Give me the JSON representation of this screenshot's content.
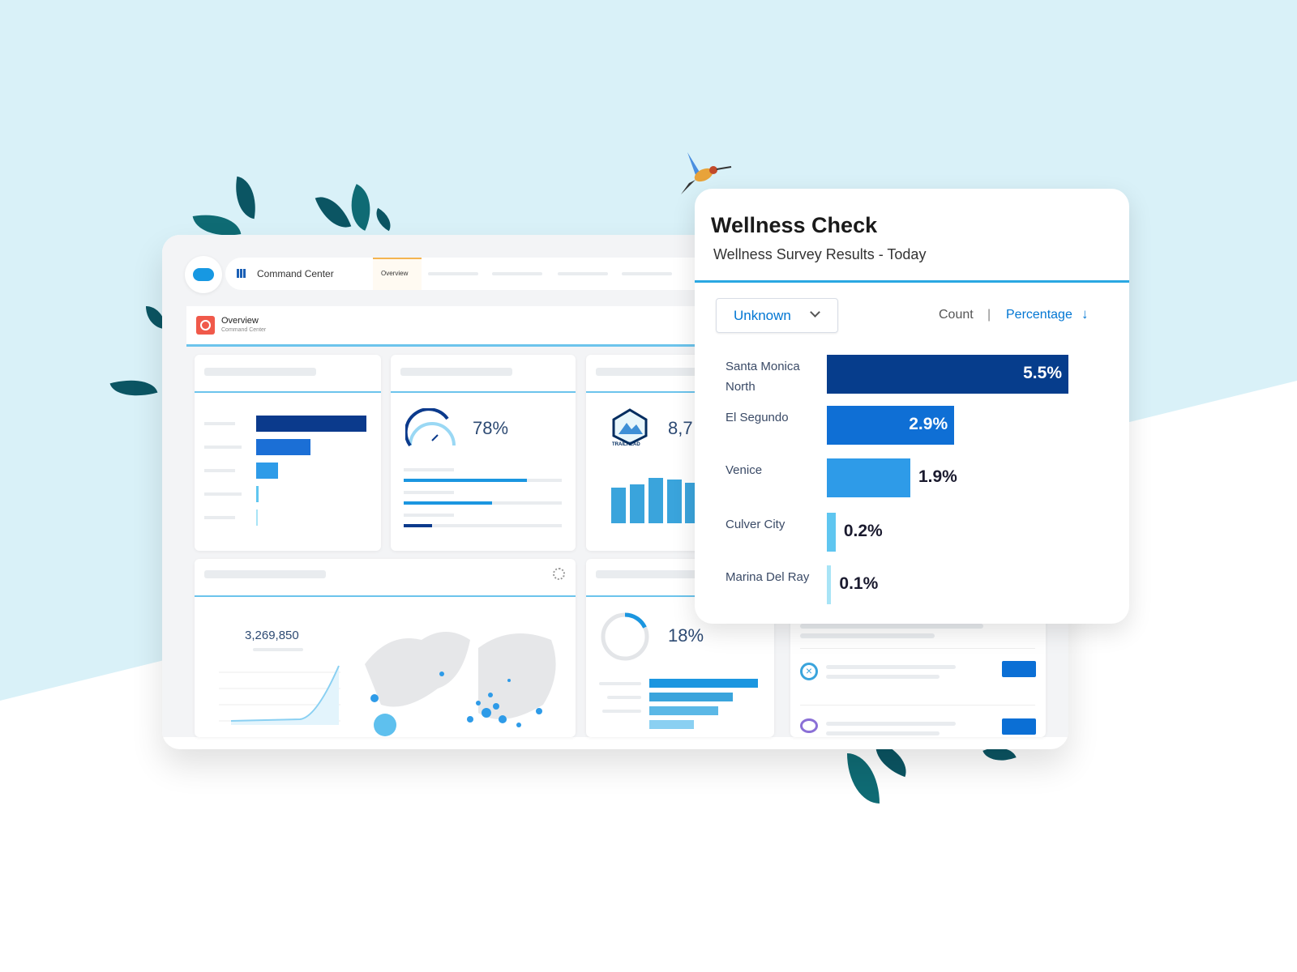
{
  "colors": {
    "background": "#d9f1f8",
    "accent": "#0176d3",
    "dark_bar": "#063d8c",
    "mid_bar": "#0f6fd5",
    "light_bar": "#2e9be8",
    "leaf": "#0b5563"
  },
  "dashboard": {
    "app_name": "Command Center",
    "active_tab": "Overview",
    "header": {
      "title": "Overview",
      "subtitle": "Command Center",
      "icon": "gauge-icon"
    },
    "gauge_value": "78%",
    "gauge_fraction": 0.78,
    "trailhead_logo": "TRAILHEAD",
    "trailhead_value": "8,7",
    "total_value": "3,269,850",
    "donut_value": "18%",
    "donut_fraction": 0.18,
    "progress_bars": [
      0.78,
      0.56,
      0.18
    ]
  },
  "wellness": {
    "title": "Wellness Check",
    "subtitle": "Wellness Survey Results - Today",
    "filter_value": "Unknown",
    "toggle": {
      "count_label": "Count",
      "separator": "|",
      "percentage_label": "Percentage",
      "sort_icon": "arrow-down-icon"
    },
    "chart_data": {
      "type": "bar",
      "orientation": "horizontal",
      "categories": [
        "Santa Monica North",
        "El Segundo",
        "Venice",
        "Culver City",
        "Marina Del Ray"
      ],
      "values": [
        5.5,
        2.9,
        1.9,
        0.2,
        0.1
      ],
      "labels": [
        "5.5%",
        "2.9%",
        "1.9%",
        "0.2%",
        "0.1%"
      ],
      "colors": [
        "#063d8c",
        "#0f6fd5",
        "#2e9be8",
        "#5fc6f0",
        "#a8e4f6"
      ],
      "unit": "%"
    }
  }
}
